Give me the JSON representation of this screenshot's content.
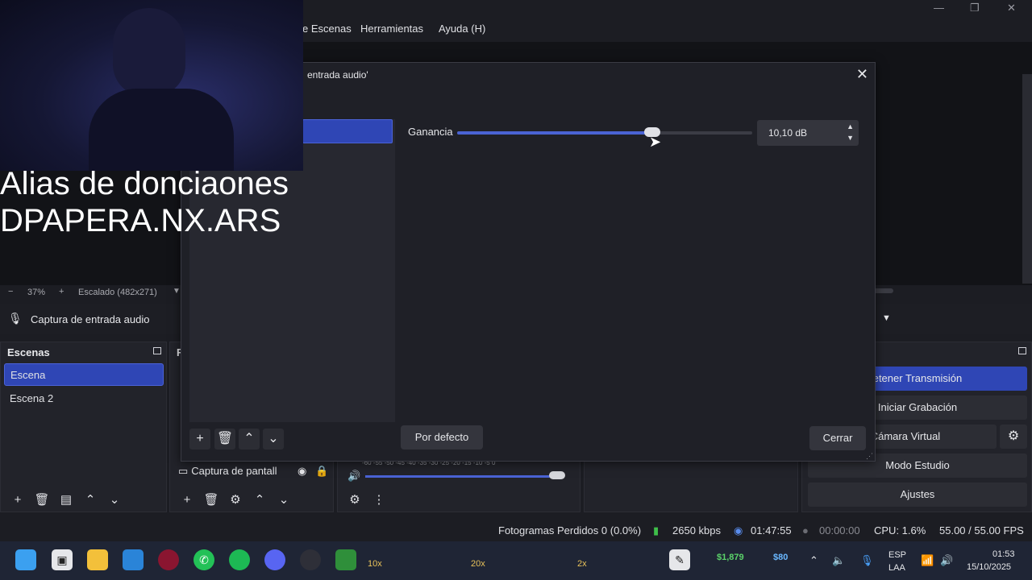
{
  "menu": {
    "items": [
      {
        "label": "e Escenas"
      },
      {
        "label": "Herramientas"
      },
      {
        "label": "Ayuda (H)"
      }
    ]
  },
  "window_controls": {
    "minimize": "—",
    "maximize": "❐",
    "close": "✕"
  },
  "preview": {
    "zoom_minus": "−",
    "zoom_value": "37%",
    "zoom_plus": "+",
    "scale_label": "Escalado (482x271)"
  },
  "source_bar": {
    "source_name": "Captura de entrada audio"
  },
  "scenes_dock": {
    "title": "Escenas",
    "items": [
      {
        "label": "Escena",
        "selected": true
      },
      {
        "label": "Escena 2",
        "selected": false
      }
    ]
  },
  "sources_dock": {
    "title_partial": "F",
    "item_label": "Captura de pantall",
    "tag_partial": "i"
  },
  "mixer": {
    "scale_ticks": "-60 -55 -50 -45 -40 -35 -30 -25 -20 -15 -10 -5 0"
  },
  "controls_dock": {
    "buttons": [
      {
        "label": "etener Transmisión",
        "active": true
      },
      {
        "label": "Iniciar Grabación",
        "active": false
      },
      {
        "label": "r Cámara Virtual",
        "active": false
      },
      {
        "label": "Modo Estudio",
        "active": false
      },
      {
        "label": "Ajustes",
        "active": false
      }
    ]
  },
  "status_bar": {
    "dropped_frames": "Fotogramas Perdidos 0 (0.0%)",
    "bitrate": "2650 kbps",
    "stream_time": "01:47:55",
    "rec_time": "00:00:00",
    "cpu": "CPU: 1.6%",
    "fps": "55.00 / 55.00 FPS"
  },
  "dialog": {
    "title": "entrada audio'",
    "close": "✕",
    "gain_label": "Ganancia",
    "gain_value": "10,10 dB",
    "gain_fraction": 0.66,
    "default_button": "Por defecto",
    "close_button": "Cerrar"
  },
  "webcam_overlay": {
    "line1": "Alias de donciaones",
    "line2": "DPAPERA.NX.ARS"
  },
  "taskbar": {
    "badges": {
      "b1": "10x",
      "b2": "20x",
      "b3": "2x"
    },
    "stock_price": "$1,879",
    "stock2_price": "$80",
    "lang": "ESP",
    "lang2": "LAA",
    "time": "01:53",
    "date": "15/10/2025"
  },
  "colors": {
    "accent": "#2f46b5",
    "background": "#1c1d23",
    "taskbar": "#1f2535"
  }
}
